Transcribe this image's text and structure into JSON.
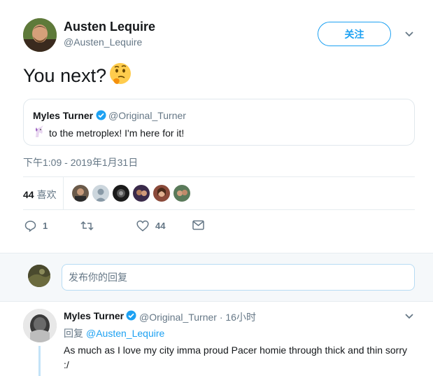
{
  "tweet": {
    "author_name": "Austen Lequire",
    "author_handle": "@Austen_Lequire",
    "follow_label": "关注",
    "text": "You next?",
    "emoji": "🤔",
    "timestamp": "下午1:09 - 2019年1月31日"
  },
  "quote": {
    "name": "Myles Turner",
    "handle": "@Original_Turner",
    "emoji": "🦄",
    "text": "to the metroplex! I'm here for it!"
  },
  "stats": {
    "likes_count": "44",
    "likes_label": "喜欢"
  },
  "actions": {
    "reply_count": "1",
    "retweet_count": "",
    "like_count": "44"
  },
  "compose": {
    "placeholder": "发布你的回复"
  },
  "reply": {
    "name": "Myles Turner",
    "handle_time": "@Original_Turner · 16小时",
    "reply_prefix": "回复",
    "reply_to": "@Austen_Lequire",
    "text": "As much as I love my city imma proud Pacer homie through thick and thin sorry :/"
  },
  "colors": {
    "accent": "#1da1f2",
    "muted": "#657786",
    "border": "#e6ecf0"
  }
}
